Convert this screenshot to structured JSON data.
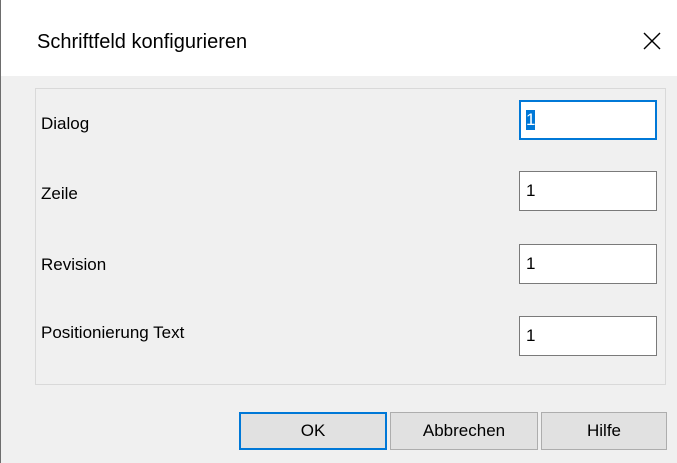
{
  "window": {
    "title": "Schriftfeld konfigurieren",
    "close_icon": "close-icon"
  },
  "fields": [
    {
      "label": "Dialog",
      "value": "1",
      "focused": true
    },
    {
      "label": "Zeile",
      "value": "1",
      "focused": false
    },
    {
      "label": "Revision",
      "value": "1",
      "focused": false
    },
    {
      "label": "Positionierung Text",
      "value": "1",
      "focused": false
    }
  ],
  "buttons": {
    "ok": "OK",
    "cancel": "Abbrechen",
    "help": "Hilfe"
  },
  "colors": {
    "accent": "#0078d7",
    "dialog_bg": "#f0f0f0",
    "button_bg": "#e1e1e1"
  }
}
